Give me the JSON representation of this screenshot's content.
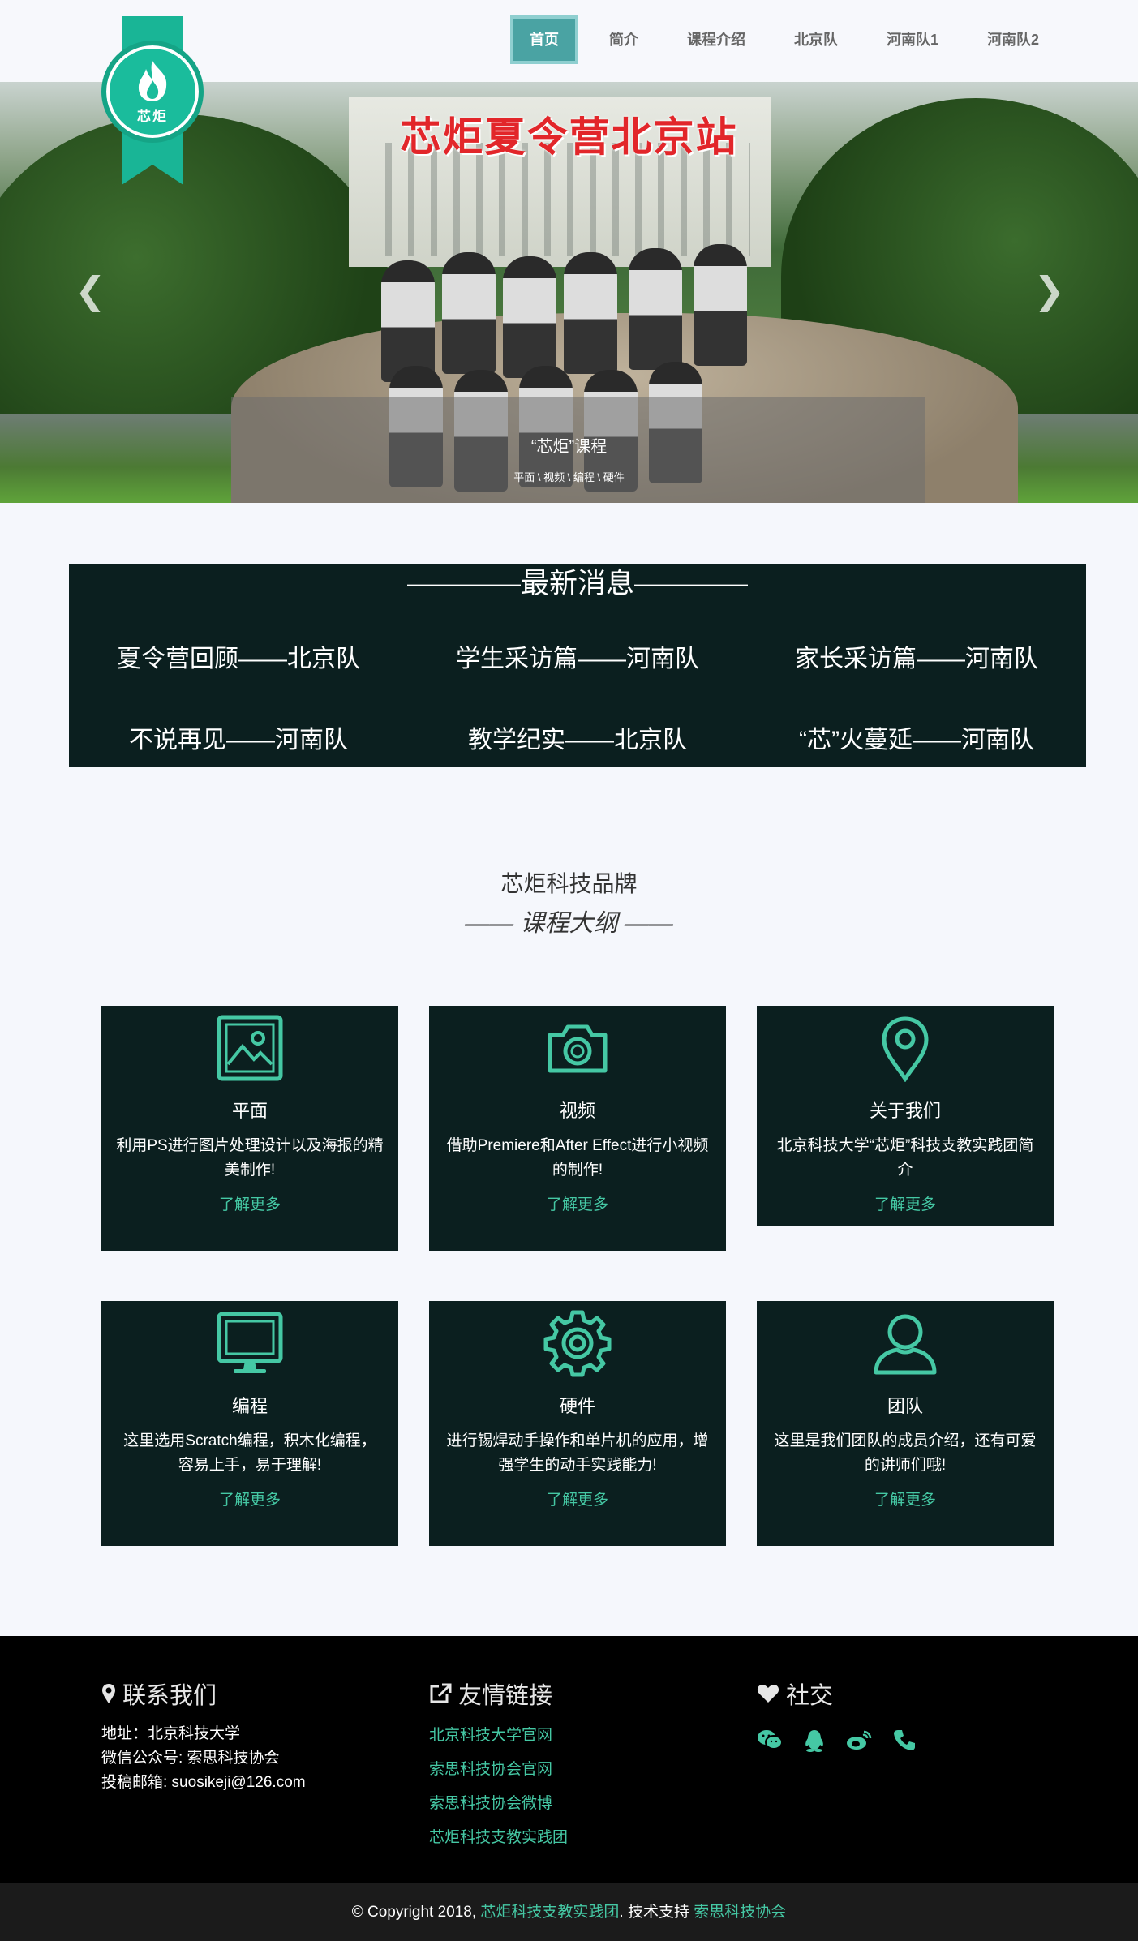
{
  "brand": {
    "logo_text": "芯炬"
  },
  "nav": [
    {
      "label": "首页"
    },
    {
      "label": "简介"
    },
    {
      "label": "课程介绍"
    },
    {
      "label": "北京队"
    },
    {
      "label": "河南队1"
    },
    {
      "label": "河南队2"
    }
  ],
  "hero": {
    "banner_text": "芯炬夏令营北京站",
    "caption_title": "“芯炬”课程",
    "caption_sub": "平面 \\ 视频 \\ 编程 \\ 硬件",
    "prev_icon": "chevron-left-icon",
    "next_icon": "chevron-right-icon"
  },
  "news": {
    "heading": "————最新消息————",
    "items": [
      "夏令营回顾——北京队",
      "学生采访篇——河南队",
      "家长采访篇——河南队",
      "不说再见——河南队",
      "教学纪实——北京队",
      "“芯”火蔓延——河南队"
    ]
  },
  "brand_section": {
    "title": "芯炬科技品牌",
    "subtitle": "—— 课程大纲 ——"
  },
  "cards": [
    {
      "icon": "image-icon",
      "title": "平面",
      "desc": "利用PS进行图片处理设计以及海报的精美制作!",
      "more": "了解更多"
    },
    {
      "icon": "camera-icon",
      "title": "视频",
      "desc": "借助Premiere和After Effect进行小视频的制作!",
      "more": "了解更多"
    },
    {
      "icon": "map-pin-icon",
      "title": "关于我们",
      "desc": "北京科技大学“芯炬”科技支教实践团简介",
      "more": "了解更多"
    },
    {
      "icon": "monitor-icon",
      "title": "编程",
      "desc": "这里选用Scratch编程，积木化编程，容易上手，易于理解!",
      "more": "了解更多"
    },
    {
      "icon": "gear-icon",
      "title": "硬件",
      "desc": "进行锡焊动手操作和单片机的应用，增强学生的动手实践能力!",
      "more": "了解更多"
    },
    {
      "icon": "user-icon",
      "title": "团队",
      "desc": "这里是我们团队的成员介绍，还有可爱的讲师们哦!",
      "more": "了解更多"
    }
  ],
  "footer": {
    "contact": {
      "heading": "联系我们",
      "icon": "map-marker-icon",
      "address": "地址：北京科技大学",
      "wechat": "微信公众号: 索思科技协会",
      "email": "投稿邮箱: suosikeji@126.com"
    },
    "links": {
      "heading": "友情链接",
      "icon": "external-link-icon",
      "items": [
        "北京科技大学官网",
        "索思科技协会官网",
        "索思科技协会微博",
        "芯炬科技支教实践团"
      ]
    },
    "social": {
      "heading": "社交",
      "icon": "heart-icon",
      "items": [
        "wechat-icon",
        "qq-icon",
        "weibo-icon",
        "phone-icon"
      ]
    }
  },
  "copyright": {
    "prefix": "© Copyright 2018,",
    "team": "芯炬科技支教实践团",
    "middle": ". 技术支持",
    "assoc": "索思科技协会"
  },
  "colors": {
    "accent": "#45c8a4",
    "dark_panel": "#0b1f1f",
    "nav_active": "#4aa3a3",
    "logo": "#1abc9c"
  }
}
